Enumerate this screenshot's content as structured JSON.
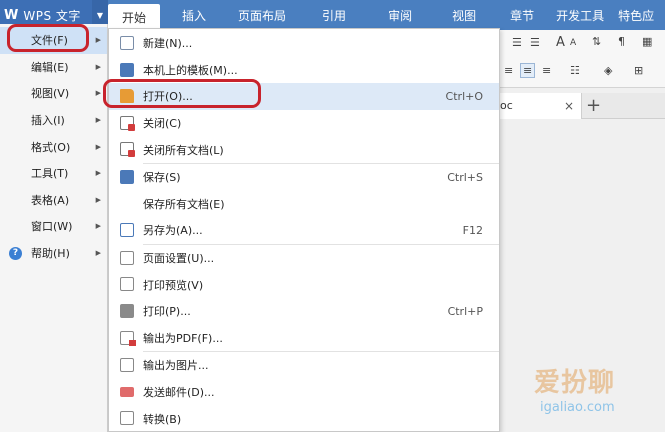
{
  "app": {
    "title": "WPS 文字",
    "logo": "W"
  },
  "tabs": [
    "开始",
    "插入",
    "页面布局",
    "引用",
    "审阅",
    "视图",
    "章节",
    "开发工具",
    "特色应"
  ],
  "main_menu": [
    {
      "label": "文件(F)",
      "has_sub": true,
      "active": true
    },
    {
      "label": "编辑(E)",
      "has_sub": true
    },
    {
      "label": "视图(V)",
      "has_sub": true
    },
    {
      "label": "插入(I)",
      "has_sub": true
    },
    {
      "label": "格式(O)",
      "has_sub": true
    },
    {
      "label": "工具(T)",
      "has_sub": true
    },
    {
      "label": "表格(A)",
      "has_sub": true
    },
    {
      "label": "窗口(W)",
      "has_sub": true
    },
    {
      "label": "帮助(H)",
      "has_sub": true,
      "icon": "help-icon"
    }
  ],
  "file_menu": [
    {
      "label": "新建(N)...",
      "shortcut": "",
      "icon": "new-doc-icon"
    },
    {
      "label": "本机上的模板(M)...",
      "shortcut": "",
      "icon": "template-icon"
    },
    {
      "label": "打开(O)...",
      "shortcut": "Ctrl+O",
      "icon": "open-folder-icon",
      "highlighted": true
    },
    {
      "label": "关闭(C)",
      "shortcut": "",
      "icon": "close-doc-icon"
    },
    {
      "label": "关闭所有文档(L)",
      "shortcut": "",
      "icon": "close-all-icon"
    },
    {
      "label": "保存(S)",
      "shortcut": "Ctrl+S",
      "icon": "save-icon"
    },
    {
      "label": "保存所有文档(E)",
      "shortcut": "",
      "icon": ""
    },
    {
      "label": "另存为(A)...",
      "shortcut": "F12",
      "icon": "save-as-icon"
    },
    {
      "label": "页面设置(U)...",
      "shortcut": "",
      "icon": "page-setup-icon"
    },
    {
      "label": "打印预览(V)",
      "shortcut": "",
      "icon": "print-preview-icon"
    },
    {
      "label": "打印(P)...",
      "shortcut": "Ctrl+P",
      "icon": "printer-icon"
    },
    {
      "label": "输出为PDF(F)...",
      "shortcut": "",
      "icon": "pdf-icon"
    },
    {
      "label": "输出为图片...",
      "shortcut": "",
      "icon": "image-export-icon"
    },
    {
      "label": "发送邮件(D)...",
      "shortcut": "",
      "icon": "mail-icon"
    },
    {
      "label": "转换(B)",
      "shortcut": "",
      "icon": "convert-icon"
    }
  ],
  "doc_tab": {
    "name": "oc",
    "close": "×",
    "add": "+"
  },
  "toolbar": {
    "font_grow": "A",
    "font_shrink": "A"
  },
  "watermark": {
    "text": "爱扮聊",
    "url": "igaliao.com"
  },
  "colors": {
    "ribbon": "#4a7fc0",
    "highlight": "#dde9f7",
    "ring": "#c8232c"
  }
}
